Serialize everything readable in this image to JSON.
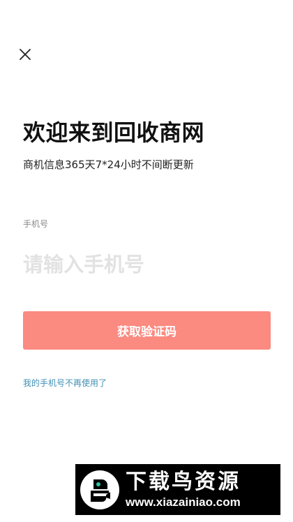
{
  "header": {
    "close_icon": "close-icon"
  },
  "welcome": {
    "title": "欢迎来到回收商网",
    "subtitle": "商机信息365天7*24小时不间断更新"
  },
  "phone": {
    "label": "手机号",
    "placeholder": "请输入手机号",
    "value": ""
  },
  "actions": {
    "get_code_label": "获取验证码",
    "phone_unavailable_link": "我的手机号不再使用了"
  },
  "watermark": {
    "name": "下载鸟资源",
    "url": "www.xiazainiao.com"
  },
  "colors": {
    "button_bg": "#fb8a80",
    "link": "#3f8fb4",
    "placeholder": "#e2e2e2"
  }
}
